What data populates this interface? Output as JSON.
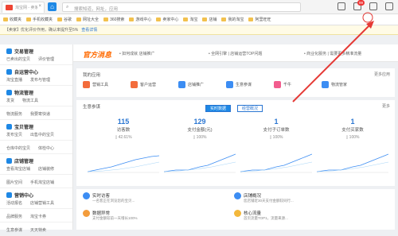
{
  "browser": {
    "tab_title": "淘宝网 - 卖家中心",
    "tab_close": "×",
    "home_label": "⌂",
    "address_placeholder": "搜索知道，网址，应用",
    "notification_count": "99"
  },
  "bookmarks": [
    "收藏夹",
    "手机收藏夹",
    "谷歌",
    "网址大全",
    "360搜索",
    "游戏中心",
    "卖家中心",
    "淘宝",
    "店铺",
    "我的淘宝",
    "阿里旺旺"
  ],
  "notice": {
    "text": "【卖家】优化评价作用，确认率提升至5%",
    "link": "查看详情"
  },
  "sidebar": [
    {
      "title": "交易管理",
      "color": "#1e88e5",
      "items": [
        "已卖出的宝贝",
        "评价管理"
      ]
    },
    {
      "title": "自运营中心",
      "color": "#1e88e5",
      "items": [
        "淘宝直播",
        "发布与管理"
      ]
    },
    {
      "title": "物流管理",
      "color": "#1e88e5",
      "items": [
        "发货",
        "物流工具"
      ]
    },
    {
      "title": "",
      "color": "#1e88e5",
      "items": [
        "物流服务",
        "我要寄快递"
      ]
    },
    {
      "title": "宝贝管理",
      "color": "#1e88e5",
      "items": [
        "发布宝贝",
        "出售中的宝贝"
      ]
    },
    {
      "title": "",
      "color": "#1e88e5",
      "items": [
        "仓库中的宝贝",
        "体检中心"
      ]
    },
    {
      "title": "店铺管理",
      "color": "#1e88e5",
      "items": [
        "查看淘宝店铺",
        "店铺装修"
      ]
    },
    {
      "title": "",
      "color": "#1e88e5",
      "items": [
        "图片空间",
        "手机淘宝店铺"
      ]
    },
    {
      "title": "营销中心",
      "color": "#1e88e5",
      "items": [
        "活动报名",
        "店铺营销工具"
      ]
    },
    {
      "title": "",
      "color": "#1e88e5",
      "items": [
        "品牌服务",
        "淘宝卡券"
      ]
    },
    {
      "title": "",
      "color": "#1e88e5",
      "items": [
        "生意参谋",
        "天天特卖"
      ]
    }
  ],
  "header": {
    "logo": "官方消息",
    "news": [
      "• 如何成就 店铺推广",
      "• 全网引擎 | 店铺运营TOP问题",
      "• 商业化服务 | 需要更多精准流量"
    ],
    "more": "更多"
  },
  "apps": {
    "title": "我的应用",
    "more": "更多应用",
    "items": [
      {
        "label": "营销工具",
        "color": "#f36c3c"
      },
      {
        "label": "客户运营",
        "color": "#f36c3c"
      },
      {
        "label": "店铺推广",
        "color": "#3c8df3"
      },
      {
        "label": "生意参谋",
        "color": "#3c8df3"
      },
      {
        "label": "千牛",
        "color": "#f25d8e"
      },
      {
        "label": "物流管家",
        "color": "#3c8df3"
      }
    ]
  },
  "stats": {
    "title": "生意参谋",
    "more": "更多",
    "tabs": [
      "实时数据",
      "经营概况"
    ],
    "items": [
      {
        "num": "115",
        "label": "访客数",
        "pct": "42.61%"
      },
      {
        "num": "129",
        "label": "支付金额(元)",
        "pct": "100%"
      },
      {
        "num": "1",
        "label": "支付子订单数",
        "pct": "100%"
      },
      {
        "num": "1",
        "label": "支付买家数",
        "pct": "100%"
      }
    ]
  },
  "tasks": [
    {
      "title": "实时访客",
      "desc": "一名客正在浏览您的宝贝...",
      "color": "#3c8df3"
    },
    {
      "title": "店铺概况",
      "desc": "您店铺近30天支付金额较同行...",
      "color": "#3c8df3"
    },
    {
      "title": "数据异常",
      "desc": "支付金额较前一天增长100%",
      "color": "#f39c3c"
    },
    {
      "title": "核心流量",
      "desc": "首页流量TOP1，流量来源...",
      "color": "#f3b83c"
    }
  ]
}
